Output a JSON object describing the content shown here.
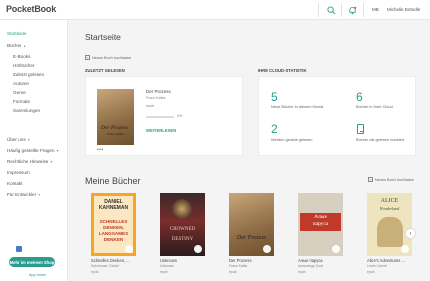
{
  "header": {
    "logo": "PocketBook",
    "user_initials": "MB",
    "user_name": "Michelle Brändle"
  },
  "sidebar": {
    "items": [
      {
        "label": "Startseite"
      },
      {
        "label": "Bücher"
      },
      {
        "label": "E-Books"
      },
      {
        "label": "Hörbücher"
      },
      {
        "label": "Zuletzt gelesen"
      },
      {
        "label": "Autoren"
      },
      {
        "label": "Genre"
      },
      {
        "label": "Formate"
      },
      {
        "label": "Sammlungen"
      },
      {
        "label": "Über uns"
      },
      {
        "label": "Häufig gestellte Fragen"
      },
      {
        "label": "Rechtliche Hinweise"
      },
      {
        "label": "Impressum"
      },
      {
        "label": "Kontakt"
      },
      {
        "label": "Für Entwickler"
      }
    ],
    "shop_button": "Mehr im meinem Shop",
    "app_link": "App holen"
  },
  "main": {
    "page_title": "Startseite",
    "add_book": "Neues Buch hochladen",
    "recent": {
      "label": "ZULETZT GELESEN",
      "title": "Der Prozess",
      "author": "Franz Kafka",
      "format": "epub",
      "progress": 0.0,
      "progress_text": "0%",
      "continue": "WEITERLESEN",
      "cover_title": "Der Prozess",
      "cover_author": "Franz Kafka"
    },
    "stats": {
      "label": "IHRE CLOUD-STATISTIK",
      "items": [
        {
          "value": "5",
          "text": "Neue Bücher in diesem Monat"
        },
        {
          "value": "6",
          "text": "Bücher in Ihrer Cloud"
        },
        {
          "value": "2",
          "text": "Werden gerade gelesen"
        },
        {
          "value": "",
          "text": "Bücher als gelesen markiert"
        }
      ]
    },
    "books_title": "Meine Bücher",
    "books_add": "Neues Buch hochladen",
    "books": [
      {
        "title": "Schnelles Denken, ...",
        "author": "Kahneman, Daniel",
        "format": "epub",
        "cover_lines": [
          "DANIEL",
          "KAHNEMAN",
          "SCHNELLES",
          "DENKEN,",
          "LANGSAMES",
          "DENKEN"
        ]
      },
      {
        "title": "Unknown",
        "author": "Unknown",
        "format": "epub",
        "cover_lines": [
          "CROWNED",
          "DESTINY"
        ]
      },
      {
        "title": "Der Prozess",
        "author": "Franz Kafka",
        "format": "epub",
        "cover_lines": [
          "Der Prozess"
        ]
      },
      {
        "title": "Алые паруса",
        "author": "Александр Грин",
        "format": "epub",
        "cover_lines": [
          "Алые",
          "паруса"
        ]
      },
      {
        "title": "Alice's Adventures ...",
        "author": "Lewis Carroll",
        "format": "epub",
        "cover_lines": [
          "ALICE",
          "Wonderland"
        ]
      }
    ]
  },
  "colors": {
    "accent": "#2a9d8f",
    "background": "#f4f4f4"
  }
}
